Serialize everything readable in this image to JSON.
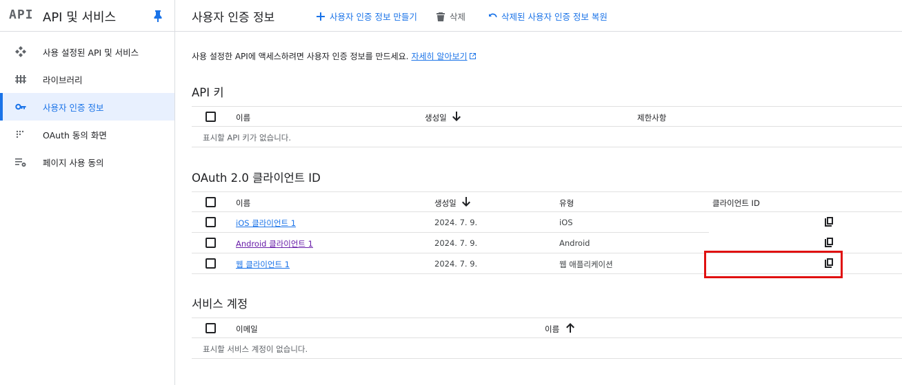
{
  "sidebar": {
    "logo": "API",
    "title": "API 및 서비스",
    "items": [
      {
        "label": "사용 설정된 API 및 서비스",
        "icon": "api-diamond-icon"
      },
      {
        "label": "라이브러리",
        "icon": "library-icon"
      },
      {
        "label": "사용자 인증 정보",
        "icon": "key-icon",
        "active": true
      },
      {
        "label": "OAuth 동의 화면",
        "icon": "oauth-dots-icon"
      },
      {
        "label": "페이지 사용 동의",
        "icon": "settings-list-icon"
      }
    ]
  },
  "topbar": {
    "title": "사용자 인증 정보",
    "create_label": "사용자 인증 정보 만들기",
    "delete_label": "삭제",
    "restore_label": "삭제된 사용자 인증 정보 복원"
  },
  "intro": {
    "text": "사용 설정한 API에 액세스하려면 사용자 인증 정보를 만드세요.",
    "link": "자세히 알아보기"
  },
  "api_keys": {
    "title": "API 키",
    "columns": [
      "이름",
      "생성일",
      "제한사항"
    ],
    "empty": "표시할 API 키가 없습니다."
  },
  "oauth": {
    "title": "OAuth 2.0 클라이언트 ID",
    "columns": [
      "이름",
      "생성일",
      "유형",
      "클라이언트 ID"
    ],
    "rows": [
      {
        "name": "iOS 클라이언트 1",
        "date": "2024. 7. 9.",
        "type": "iOS"
      },
      {
        "name": "Android 클라이언트 1",
        "date": "2024. 7. 9.",
        "type": "Android"
      },
      {
        "name": "웹 클라이언트 1",
        "date": "2024. 7. 9.",
        "type": "웹 애플리케이션"
      }
    ]
  },
  "service_accounts": {
    "title": "서비스 계정",
    "columns": [
      "이메일",
      "이름"
    ],
    "empty": "표시할 서비스 계정이 없습니다."
  },
  "colors": {
    "accent": "#1a73e8",
    "visited": "#681da8",
    "highlight": "#e01010"
  }
}
